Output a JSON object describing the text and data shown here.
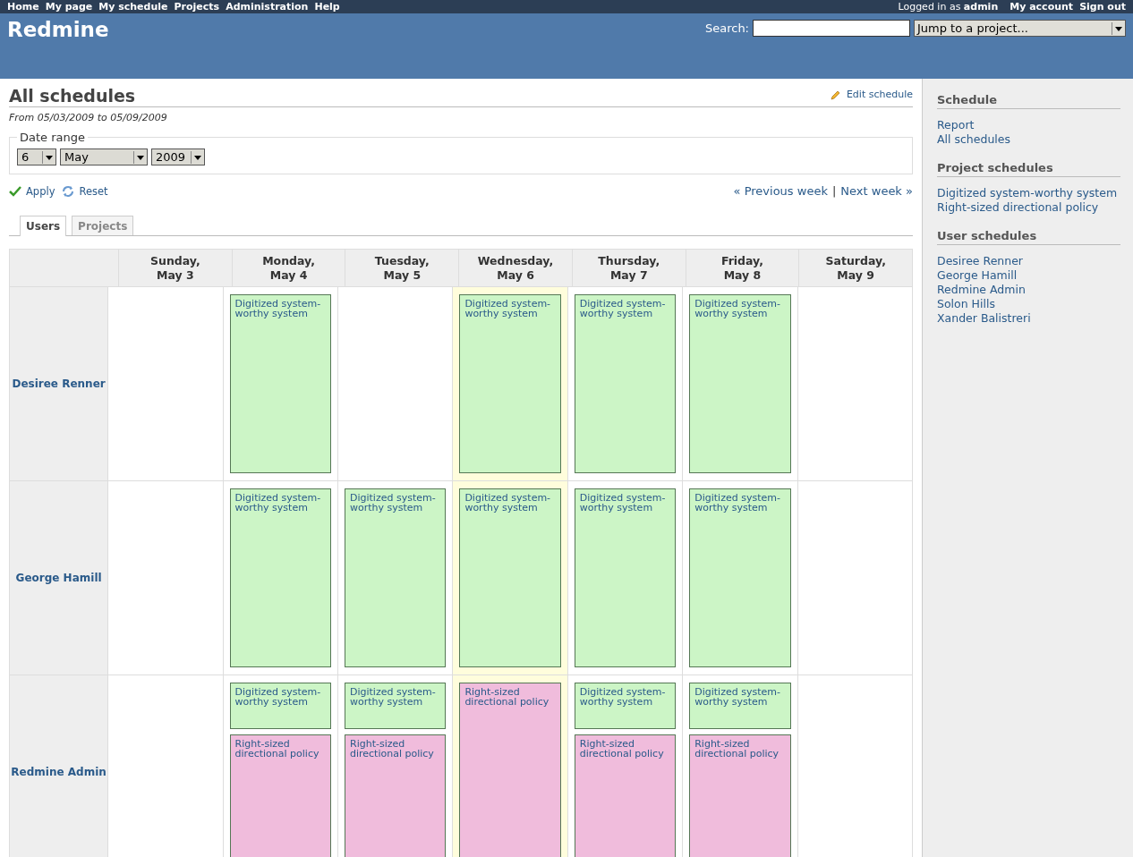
{
  "top_menu": [
    "Home",
    "My page",
    "My schedule",
    "Projects",
    "Administration",
    "Help"
  ],
  "account": {
    "logged_in_label": "Logged in as",
    "user": "admin",
    "links": [
      "My account",
      "Sign out"
    ]
  },
  "header": {
    "title": "Redmine",
    "search_label": "Search:",
    "jump": "Jump to a project..."
  },
  "page": {
    "title": "All schedules",
    "edit_link": "Edit schedule",
    "range_text": "From 05/03/2009 to 05/09/2009"
  },
  "date_range": {
    "legend": "Date range",
    "day": "6",
    "month": "May",
    "year": "2009"
  },
  "actions": {
    "apply": "Apply",
    "reset": "Reset",
    "previous": "« Previous week",
    "separator": "|",
    "next": "Next week »"
  },
  "tabs": [
    {
      "label": "Users",
      "selected": true
    },
    {
      "label": "Projects",
      "selected": false
    }
  ],
  "days": [
    {
      "weekday": "Sunday,",
      "date": "May 3",
      "today": false
    },
    {
      "weekday": "Monday,",
      "date": "May 4",
      "today": false
    },
    {
      "weekday": "Tuesday,",
      "date": "May 5",
      "today": false
    },
    {
      "weekday": "Wednesday,",
      "date": "May 6",
      "today": true
    },
    {
      "weekday": "Thursday,",
      "date": "May 7",
      "today": false
    },
    {
      "weekday": "Friday,",
      "date": "May 8",
      "today": false
    },
    {
      "weekday": "Saturday,",
      "date": "May 9",
      "today": false
    }
  ],
  "rows": [
    {
      "user": "Desiree Renner",
      "cells": [
        [],
        [
          {
            "project": "Digitized system-worthy system",
            "color": "#ccf5c6"
          }
        ],
        [],
        [
          {
            "project": "Digitized system-worthy system",
            "color": "#ccf5c6"
          }
        ],
        [
          {
            "project": "Digitized system-worthy system",
            "color": "#ccf5c6"
          }
        ],
        [
          {
            "project": "Digitized system-worthy system",
            "color": "#ccf5c6"
          }
        ],
        []
      ]
    },
    {
      "user": "George Hamill",
      "cells": [
        [],
        [
          {
            "project": "Digitized system-worthy system",
            "color": "#ccf5c6"
          }
        ],
        [
          {
            "project": "Digitized system-worthy system",
            "color": "#ccf5c6"
          }
        ],
        [
          {
            "project": "Digitized system-worthy system",
            "color": "#ccf5c6"
          }
        ],
        [
          {
            "project": "Digitized system-worthy system",
            "color": "#ccf5c6"
          }
        ],
        [
          {
            "project": "Digitized system-worthy system",
            "color": "#ccf5c6"
          }
        ],
        []
      ]
    },
    {
      "user": "Redmine Admin",
      "cells": [
        [],
        [
          {
            "project": "Digitized system-worthy system",
            "color": "#ccf5c6"
          },
          {
            "project": "Right-sized directional policy",
            "color": "#f0bcdc"
          }
        ],
        [
          {
            "project": "Digitized system-worthy system",
            "color": "#ccf5c6"
          },
          {
            "project": "Right-sized directional policy",
            "color": "#f0bcdc"
          }
        ],
        [
          {
            "project": "Right-sized directional policy",
            "color": "#f0bcdc"
          }
        ],
        [
          {
            "project": "Digitized system-worthy system",
            "color": "#ccf5c6"
          },
          {
            "project": "Right-sized directional policy",
            "color": "#f0bcdc"
          }
        ],
        [
          {
            "project": "Digitized system-worthy system",
            "color": "#ccf5c6"
          },
          {
            "project": "Right-sized directional policy",
            "color": "#f0bcdc"
          }
        ],
        []
      ]
    }
  ],
  "sidebar": [
    {
      "heading": "Schedule",
      "links": [
        "Report",
        "All schedules"
      ]
    },
    {
      "heading": "Project schedules",
      "links": [
        "Digitized system-worthy system",
        "Right-sized directional policy"
      ]
    },
    {
      "heading": "User schedules",
      "links": [
        "Desiree Renner",
        "George Hamill",
        "Redmine Admin",
        "Solon Hills",
        "Xander Balistreri"
      ]
    }
  ]
}
